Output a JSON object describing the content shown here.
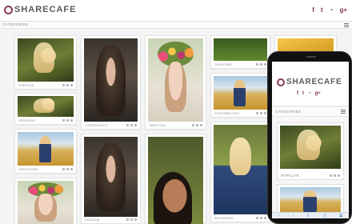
{
  "brand": {
    "name": "SHARECAFE",
    "accent": "#8a3a5e"
  },
  "social": [
    {
      "icon": "facebook-icon",
      "glyph": "f"
    },
    {
      "icon": "twitter-icon",
      "glyph": "t"
    },
    {
      "icon": "rss-icon",
      "glyph": "◔"
    },
    {
      "icon": "google-plus-icon",
      "glyph": "g+"
    }
  ],
  "categories_label": "CATEGORIES",
  "cards": {
    "c1": "POPULAR",
    "c2": "VERSIONS",
    "c3": "VARIATIONS",
    "c4": "",
    "c5": "TOPBROUGHT",
    "c6": "",
    "c7": "TWEETING",
    "c8": "",
    "c9": "CAREFREE",
    "c10": "CONTRIBUTING",
    "c11": "KEYWORDS",
    "c12": "",
    "c13": "RANDOM"
  },
  "phone": {
    "logo": "SHARECAFE",
    "categories_label": "CATEGORIES",
    "card_caption": "POPULAR",
    "browser_bar": [
      "‹",
      "›",
      "⇧",
      "▢",
      "⧉"
    ]
  }
}
